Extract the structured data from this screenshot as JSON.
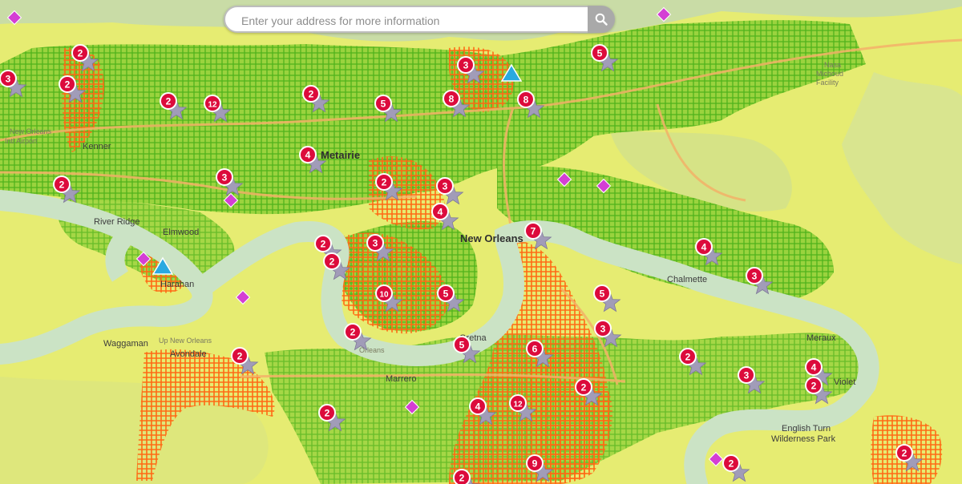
{
  "search": {
    "placeholder": "Enter your address for more information",
    "button_icon": "search-icon"
  },
  "place_labels": [
    {
      "name": "New Orleans Intl Airport",
      "lines": [
        "New Orleans",
        "Intl Airport"
      ]
    },
    {
      "name": "Kenner",
      "lines": [
        "Kenner"
      ]
    },
    {
      "name": "Metairie",
      "lines": [
        "Metairie"
      ]
    },
    {
      "name": "River Ridge",
      "lines": [
        "River Ridge"
      ]
    },
    {
      "name": "Elmwood",
      "lines": [
        "Elmwood"
      ]
    },
    {
      "name": "Harahan",
      "lines": [
        "Harahan"
      ]
    },
    {
      "name": "New Orleans",
      "lines": [
        "New Orleans"
      ]
    },
    {
      "name": "Chalmette",
      "lines": [
        "Chalmette"
      ]
    },
    {
      "name": "Waggaman",
      "lines": [
        "Waggaman"
      ]
    },
    {
      "name": "Avondale",
      "lines": [
        "Avondale"
      ]
    },
    {
      "name": "Gretna",
      "lines": [
        "Gretna"
      ]
    },
    {
      "name": "Marrero",
      "lines": [
        "Marrero"
      ]
    },
    {
      "name": "Meraux",
      "lines": [
        "Meraux"
      ]
    },
    {
      "name": "Violet",
      "lines": [
        "Violet"
      ]
    },
    {
      "name": "English Turn Wilderness Park",
      "lines": [
        "English Turn",
        "Wilderness Park"
      ]
    },
    {
      "name": "Nasa Michoud Facility",
      "lines": [
        "Nasa",
        "Michoud",
        "Facility"
      ]
    },
    {
      "name": "Upper New Orleans",
      "lines": [
        "Up New Orleans"
      ]
    },
    {
      "name": "Mississippi River",
      "lines": [
        "Orleans"
      ]
    }
  ],
  "cluster_markers": [
    {
      "count": "2"
    },
    {
      "count": "3"
    },
    {
      "count": "2"
    },
    {
      "count": "2"
    },
    {
      "count": "12"
    },
    {
      "count": "2"
    },
    {
      "count": "5"
    },
    {
      "count": "3"
    },
    {
      "count": "8"
    },
    {
      "count": "8"
    },
    {
      "count": "5"
    },
    {
      "count": "4"
    },
    {
      "count": "3"
    },
    {
      "count": "2"
    },
    {
      "count": "2"
    },
    {
      "count": "3"
    },
    {
      "count": "4"
    },
    {
      "count": "7"
    },
    {
      "count": "2"
    },
    {
      "count": "2"
    },
    {
      "count": "3"
    },
    {
      "count": "4"
    },
    {
      "count": "3"
    },
    {
      "count": "10"
    },
    {
      "count": "5"
    },
    {
      "count": "5"
    },
    {
      "count": "2"
    },
    {
      "count": "5"
    },
    {
      "count": "6"
    },
    {
      "count": "3"
    },
    {
      "count": "2"
    },
    {
      "count": "2"
    },
    {
      "count": "3"
    },
    {
      "count": "4"
    },
    {
      "count": "2"
    },
    {
      "count": "2"
    },
    {
      "count": "4"
    },
    {
      "count": "12"
    },
    {
      "count": "2"
    },
    {
      "count": "9"
    },
    {
      "count": "2"
    },
    {
      "count": "2"
    },
    {
      "count": "2"
    }
  ],
  "triangle_markers": [
    {
      "type": "triangle",
      "color": "#29a9e0"
    },
    {
      "type": "triangle",
      "color": "#29a9e0"
    }
  ],
  "diamond_markers": [
    {
      "type": "diamond",
      "color": "#d43fd4"
    },
    {
      "type": "diamond",
      "color": "#d43fd4"
    },
    {
      "type": "diamond",
      "color": "#d43fd4"
    },
    {
      "type": "diamond",
      "color": "#d43fd4"
    },
    {
      "type": "diamond",
      "color": "#d43fd4"
    },
    {
      "type": "diamond",
      "color": "#d43fd4"
    },
    {
      "type": "diamond",
      "color": "#d43fd4"
    },
    {
      "type": "diamond",
      "color": "#d43fd4"
    },
    {
      "type": "diamond",
      "color": "#d43fd4"
    }
  ],
  "colors": {
    "base_map": "#e6ec72",
    "river": "#cbe3c5",
    "lake": "#c9dca6",
    "network_ok": "#5dc21f",
    "network_outage": "#ff6a14",
    "major_road": "#f3b268",
    "badge": "#dc0b3c",
    "star": "#a19cb8"
  }
}
